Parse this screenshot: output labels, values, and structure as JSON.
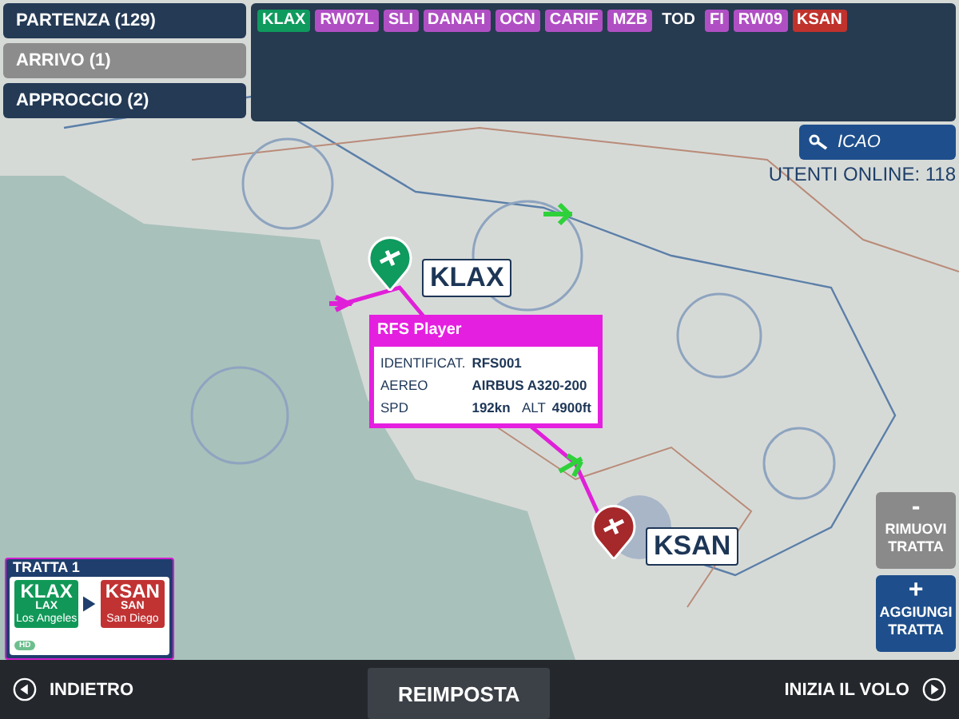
{
  "tabs": [
    {
      "label": "PARTENZA (129)",
      "selected": false
    },
    {
      "label": "ARRIVO (1)",
      "selected": true
    },
    {
      "label": "APPROCCIO (2)",
      "selected": false
    }
  ],
  "route": [
    {
      "label": "KLAX",
      "kind": "origin"
    },
    {
      "label": "RW07L",
      "kind": "waypoint"
    },
    {
      "label": "SLI",
      "kind": "waypoint"
    },
    {
      "label": "DANAH",
      "kind": "waypoint"
    },
    {
      "label": "OCN",
      "kind": "waypoint"
    },
    {
      "label": "CARIF",
      "kind": "waypoint"
    },
    {
      "label": "MZB",
      "kind": "waypoint"
    },
    {
      "label": "TOD",
      "kind": "marker"
    },
    {
      "label": "FI",
      "kind": "waypoint"
    },
    {
      "label": "RW09",
      "kind": "waypoint"
    },
    {
      "label": "KSAN",
      "kind": "destination"
    }
  ],
  "search": {
    "placeholder": "ICAO"
  },
  "users_online": "UTENTI ONLINE: 118",
  "markers": [
    {
      "label": "KLAX",
      "kind": "origin"
    },
    {
      "label": "KSAN",
      "kind": "destination"
    }
  ],
  "player_popup": {
    "title": "RFS Player",
    "id_label": "IDENTIFICAT.",
    "id": "RFS001",
    "aircraft_label": "AEREO",
    "aircraft": "AIRBUS A320-200",
    "speed_label": "SPD",
    "speed": "192kn",
    "alt_label": "ALT",
    "altitude": "4900ft"
  },
  "leg_card": {
    "title": "TRATTA 1",
    "from": {
      "icao": "KLAX",
      "iata": "LAX",
      "city": "Los Angeles"
    },
    "to": {
      "icao": "KSAN",
      "iata": "SAN",
      "city": "San Diego"
    },
    "badge": "HD"
  },
  "side_buttons": [
    {
      "symbol": "-",
      "label": "RIMUOVI TRATTA",
      "kind": "remove"
    },
    {
      "symbol": "+",
      "label": "AGGIUNGI TRATTA",
      "kind": "add"
    }
  ],
  "bottom": {
    "back": "INDIETRO",
    "reset": "REIMPOSTA",
    "start": "INIZIA IL VOLO"
  }
}
